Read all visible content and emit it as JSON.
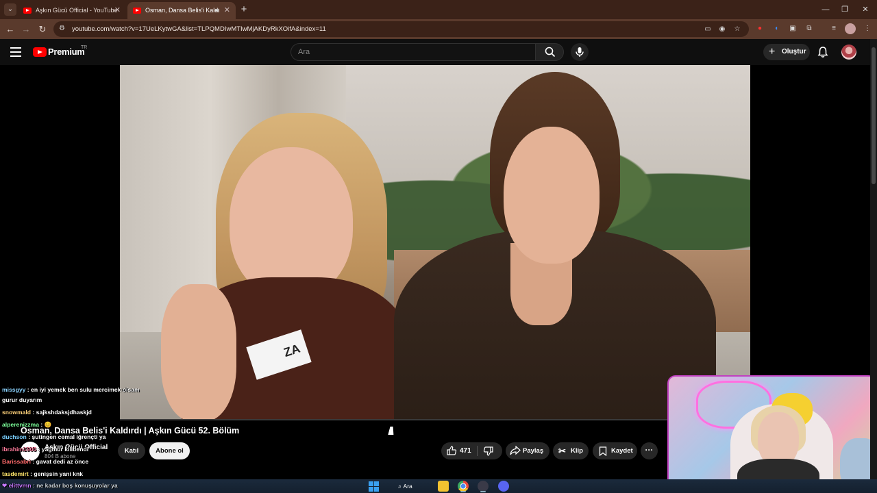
{
  "browser": {
    "tabs": [
      {
        "title": "Aşkın Gücü Official - YouTube",
        "active": false
      },
      {
        "title": "Osman, Dansa Belis'i Kaldı",
        "active": true
      }
    ],
    "new_tab": "+",
    "close_glyph": "✕",
    "url": "youtube.com/watch?v=17UeLKytwGA&list=TLPQMDIwMTIwMjAKDyRkXOifA&index=11",
    "window_controls": [
      "—",
      "❐",
      "✕"
    ]
  },
  "youtube": {
    "logo_text": "Premium",
    "country": "TR",
    "search_placeholder": "Ara",
    "create_label": "Oluştur"
  },
  "video": {
    "title": "Osman, Dansa Belis'i Kaldırdı | Aşkın Gücü 52. Bölüm",
    "badge_text": "ZA",
    "channel_name": "Aşkın Gücü Official",
    "subscribers": "804 B abone",
    "join_label": "Katıl",
    "subscribe_label": "Abone ol",
    "likes": "471",
    "share_label": "Paylaş",
    "clip_label": "Klip",
    "save_label": "Kaydet",
    "more_label": "···"
  },
  "chat": [
    {
      "user": "missgyy",
      "msg": ": en iyi yemek ben sulu mercimek olsam",
      "color": "#8bd3ff"
    },
    {
      "user": "",
      "msg": "gurur duyarım",
      "color": "#ffffff"
    },
    {
      "user": "snowmald",
      "msg": ": sajkshdaksjdhaskjd",
      "color": "#ffd27a"
    },
    {
      "user": "alperenizzma",
      "msg": ": 😊",
      "color": "#7cff9a"
    },
    {
      "user": "duchson",
      "msg": ": şutingen cemal iğrençti ya",
      "color": "#7ad0ff"
    },
    {
      "user": "ibrahim1905",
      "msg": ": yağmur kilitlendi",
      "color": "#ff7a9a"
    },
    {
      "user": "Barissabri",
      "msg": ": gavat dedi az önce",
      "color": "#ff6a6a"
    },
    {
      "user": "tasdemirt",
      "msg": ": genişsin yani knk",
      "color": "#ffe56a"
    },
    {
      "user": "elittvmn",
      "msg": ": ne kadar boş konuşuyolar ya",
      "color": "#c77aff"
    }
  ],
  "taskbar": {
    "search_label": "Ara"
  },
  "icons": [
    "chevron-down-icon",
    "youtube-tab-icon",
    "audio-icon",
    "close-icon",
    "back-icon",
    "forward-icon",
    "reload-icon",
    "site-info-icon",
    "cast-icon",
    "eye-off-icon",
    "star-icon",
    "extension-icon",
    "menu-icon",
    "hamburger-icon",
    "search-icon",
    "mic-icon",
    "plus-icon",
    "bell-icon",
    "like-icon",
    "dislike-icon",
    "share-icon",
    "scissors-icon",
    "bookmark-icon",
    "windows-icon"
  ]
}
